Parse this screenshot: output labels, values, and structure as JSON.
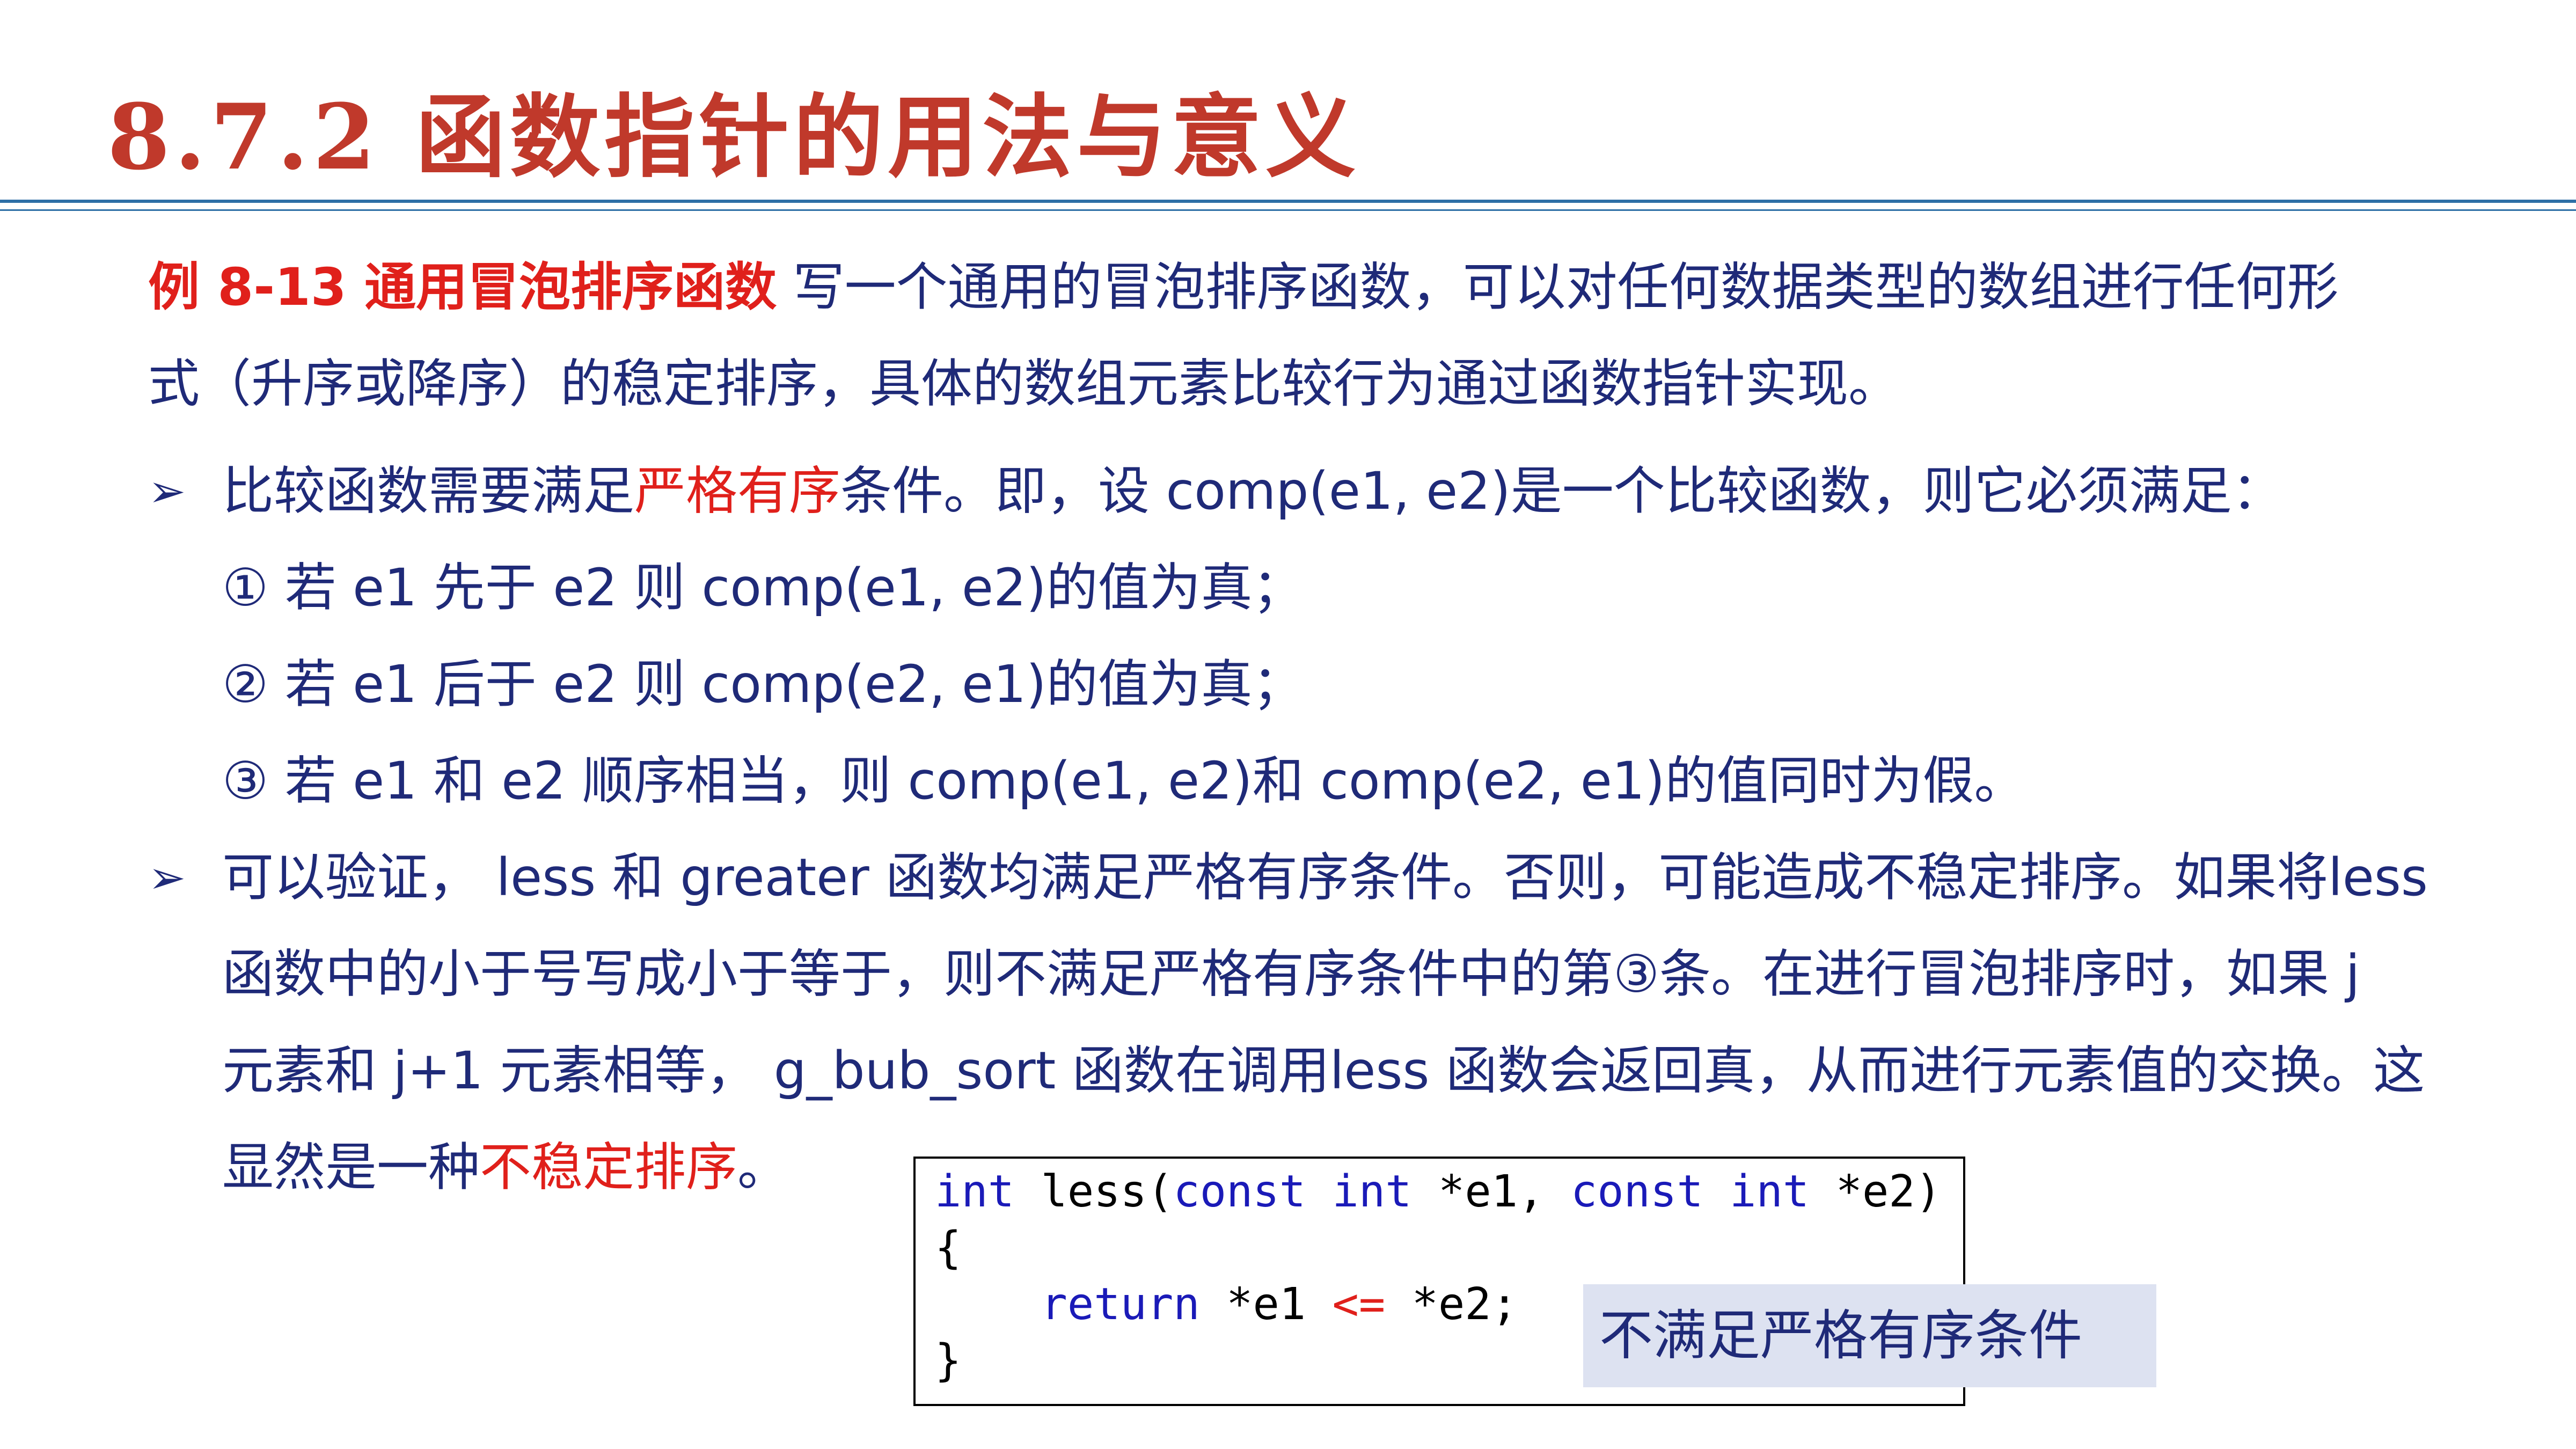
{
  "title": "8.7.2 函数指针的用法与意义",
  "example": {
    "label": "例 8-13 通用冒泡排序函数",
    "line1_rest": " 写一个通用的冒泡排序函数，可以对任何数据类型的数组进行任何形",
    "line2": "式（升序或降序）的稳定排序，具体的数组元素比较行为通过函数指针实现。"
  },
  "bullet1": {
    "arrow": "➢",
    "pre": "比较函数需要满足",
    "highlight": "严格有序",
    "post": "条件。即，设 comp(e1, e2)是一个比较函数，则它必须满足：",
    "items": [
      "① 若 e1 先于 e2 则 comp(e1, e2)的值为真；",
      "② 若 e1 后于 e2 则 comp(e2, e1)的值为真；",
      "③ 若 e1 和 e2 顺序相当，则 comp(e1, e2)和 comp(e2, e1)的值同时为假。"
    ]
  },
  "bullet2": {
    "arrow": "➢",
    "line1": "可以验证， less 和 greater 函数均满足严格有序条件。否则，可能造成不稳定排序。如果将less",
    "line2": "函数中的小于号写成小于等于，则不满足严格有序条件中的第③条。在进行冒泡排序时，如果 j",
    "line3": "元素和 j+1 元素相等， g_bub_sort 函数在调用less 函数会返回真，从而进行元素值的交换。这",
    "line4_pre": "显然是一种",
    "line4_highlight": "不稳定排序",
    "line4_post": "。"
  },
  "code": {
    "l1_kw1": "int",
    "l1_t1": " less(",
    "l1_kw2": "const",
    "l1_t2": " ",
    "l1_kw3": "int",
    "l1_t3": " *e1, ",
    "l1_kw4": "const",
    "l1_t4": " ",
    "l1_kw5": "int",
    "l1_t5": " *e2)",
    "l2": "{",
    "l3_indent": "    ",
    "l3_kw": "return",
    "l3_t1": " *e1 ",
    "l3_op": "<=",
    "l3_t2": " *e2;",
    "l4": "}"
  },
  "note": "不满足严格有序条件"
}
